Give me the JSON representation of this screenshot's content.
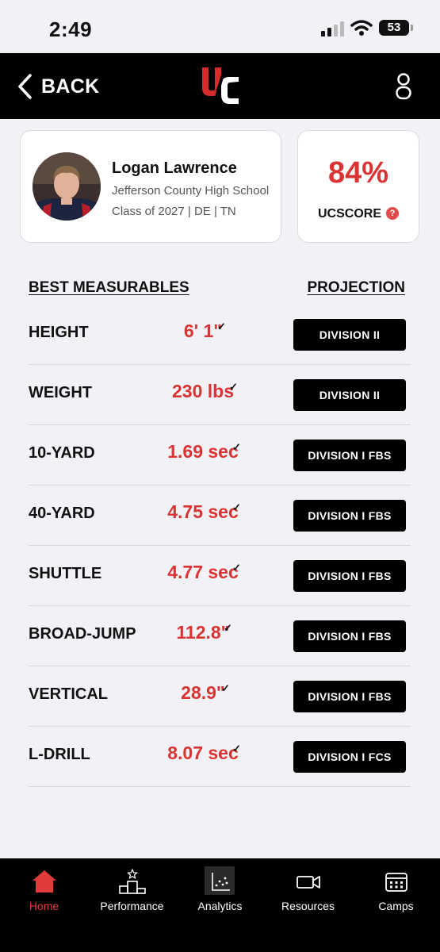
{
  "status_bar": {
    "time": "2:49",
    "battery": "53"
  },
  "header": {
    "back_label": "BACK",
    "logo_text": "UC"
  },
  "profile": {
    "name": "Logan Lawrence",
    "school": "Jefferson County High School",
    "class_info": "Class of 2027 | DE | TN"
  },
  "score": {
    "value": "84%",
    "label": "UCSCORE",
    "help": "?"
  },
  "measurables": {
    "title": "BEST MEASURABLES",
    "projection_title": "PROJECTION",
    "rows": [
      {
        "label": "HEIGHT",
        "value": "6' 1\"",
        "check": "✓",
        "projection": "DIVISION II"
      },
      {
        "label": "WEIGHT",
        "value": "230 lbs",
        "check": "✓",
        "projection": "DIVISION II"
      },
      {
        "label": "10-YARD",
        "value": "1.69 sec",
        "check": "✓",
        "projection": "DIVISION I FBS"
      },
      {
        "label": "40-YARD",
        "value": "4.75 sec",
        "check": "✓",
        "projection": "DIVISION I FBS"
      },
      {
        "label": "SHUTTLE",
        "value": "4.77 sec",
        "check": "✓",
        "projection": "DIVISION I FBS"
      },
      {
        "label": "BROAD-JUMP",
        "value": "112.8\"",
        "check": "✓",
        "projection": "DIVISION I FBS"
      },
      {
        "label": "VERTICAL",
        "value": "28.9\"",
        "check": "✓",
        "projection": "DIVISION I FBS"
      },
      {
        "label": "L-DRILL",
        "value": "8.07 sec",
        "check": "✓",
        "projection": "DIVISION I FCS"
      }
    ]
  },
  "tabs": [
    {
      "label": "Home",
      "icon": "home-icon",
      "active": true
    },
    {
      "label": "Performance",
      "icon": "podium-icon",
      "active": false
    },
    {
      "label": "Analytics",
      "icon": "scatter-chart-icon",
      "active": false
    },
    {
      "label": "Resources",
      "icon": "video-camera-icon",
      "active": false
    },
    {
      "label": "Camps",
      "icon": "calendar-icon",
      "active": false
    }
  ],
  "colors": {
    "accent": "#d93333",
    "header_bg": "#000000",
    "page_bg": "#f2f1f6"
  }
}
